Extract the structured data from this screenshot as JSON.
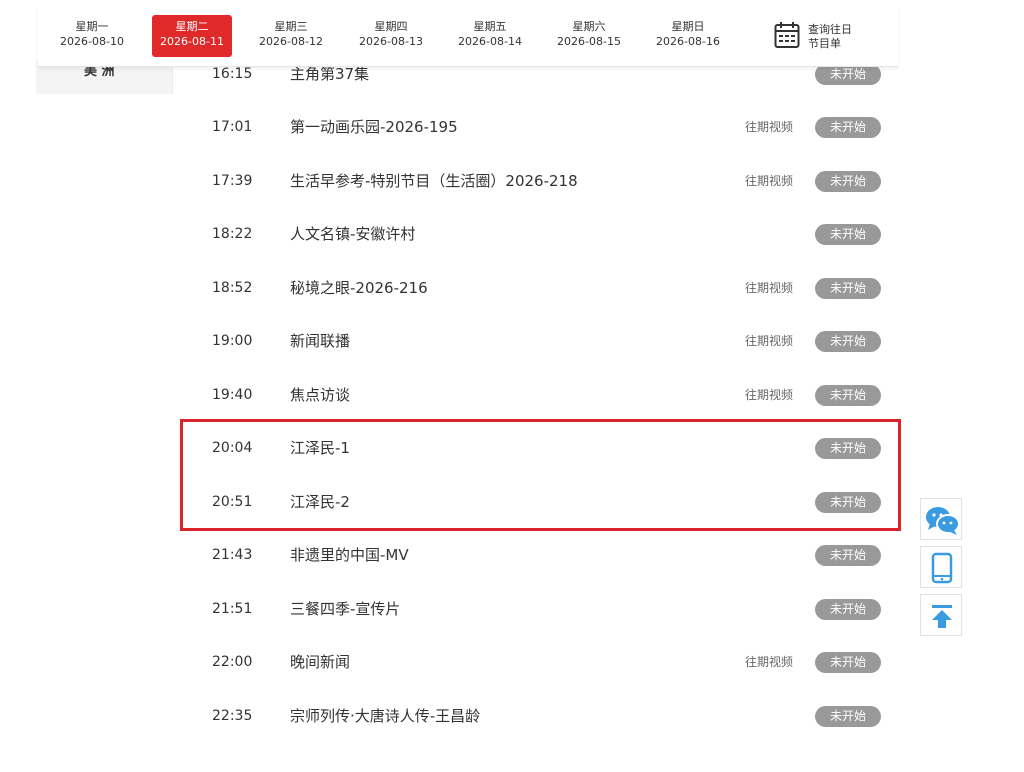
{
  "date_bar": {
    "days": [
      {
        "weekday": "星期一",
        "date": "2026-08-10",
        "active": false
      },
      {
        "weekday": "星期二",
        "date": "2026-08-11",
        "active": true
      },
      {
        "weekday": "星期三",
        "date": "2026-08-12",
        "active": false
      },
      {
        "weekday": "星期四",
        "date": "2026-08-13",
        "active": false
      },
      {
        "weekday": "星期五",
        "date": "2026-08-14",
        "active": false
      },
      {
        "weekday": "星期六",
        "date": "2026-08-15",
        "active": false
      },
      {
        "weekday": "星期日",
        "date": "2026-08-16",
        "active": false
      }
    ],
    "history_line1": "查询往日",
    "history_line2": "节目单",
    "history_icon": "calendar-icon"
  },
  "sidebar": {
    "partial_label": "美 洲"
  },
  "programs": [
    {
      "time": "16:15",
      "name": "主角第37集",
      "past_video": "",
      "status": "未开始"
    },
    {
      "time": "17:01",
      "name": "第一动画乐园-2026-195",
      "past_video": "往期视频",
      "status": "未开始"
    },
    {
      "time": "17:39",
      "name": "生活早参考-特别节目（生活圈）2026-218",
      "past_video": "往期视频",
      "status": "未开始"
    },
    {
      "time": "18:22",
      "name": "人文名镇-安徽许村",
      "past_video": "",
      "status": "未开始"
    },
    {
      "time": "18:52",
      "name": "秘境之眼-2026-216",
      "past_video": "往期视频",
      "status": "未开始"
    },
    {
      "time": "19:00",
      "name": "新闻联播",
      "past_video": "往期视频",
      "status": "未开始"
    },
    {
      "time": "19:40",
      "name": "焦点访谈",
      "past_video": "往期视频",
      "status": "未开始"
    },
    {
      "time": "20:04",
      "name": "江泽民-1",
      "past_video": "",
      "status": "未开始"
    },
    {
      "time": "20:51",
      "name": "江泽民-2",
      "past_video": "",
      "status": "未开始"
    },
    {
      "time": "21:43",
      "name": "非遗里的中国-MV",
      "past_video": "",
      "status": "未开始"
    },
    {
      "time": "21:51",
      "name": "三餐四季-宣传片",
      "past_video": "",
      "status": "未开始"
    },
    {
      "time": "22:00",
      "name": "晚间新闻",
      "past_video": "往期视频",
      "status": "未开始"
    },
    {
      "time": "22:35",
      "name": "宗师列传·大唐诗人传-王昌龄",
      "past_video": "",
      "status": "未开始"
    }
  ],
  "tools": {
    "wechat_icon": "wechat-icon",
    "mobile_icon": "mobile-phone-icon",
    "top_icon": "back-to-top-icon"
  },
  "colors": {
    "active_red": "#e02a2a",
    "highlight_red": "#d9232d",
    "status_gray": "#999999",
    "tool_blue": "#3a9be0"
  }
}
